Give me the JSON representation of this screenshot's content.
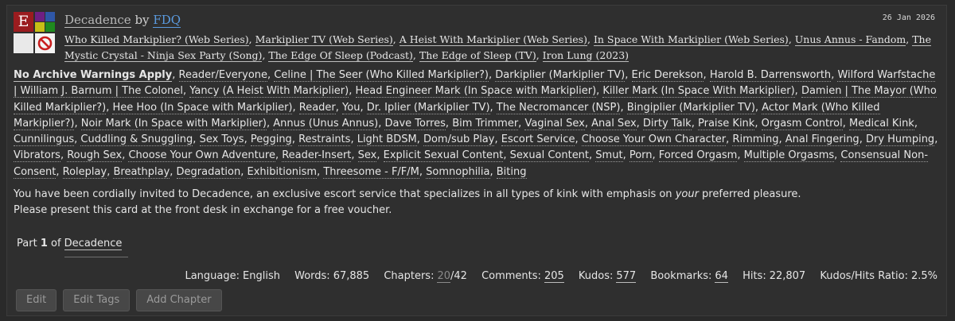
{
  "required_tags": {
    "rating_symbol": "E",
    "rating_color": "#9b1c1f",
    "category_colors": [
      "#6f1f83",
      "#2f57a7",
      "#c8be16",
      "#1f8a1f"
    ],
    "warning_color": "#e9e9e9",
    "status_icon": "no-circle-icon"
  },
  "work": {
    "title": "Decadence",
    "by": "by",
    "author": "FDQ",
    "date": "26 Jan 2026"
  },
  "fandoms": [
    "Who Killed Markiplier? (Web Series)",
    "Markiplier TV (Web Series)",
    "A Heist With Markiplier (Web Series)",
    "In Space With Markiplier (Web Series)",
    "Unus Annus - Fandom",
    "The Mystic Crystal - Ninja Sex Party (Song)",
    "The Edge Of Sleep (Podcast)",
    "The Edge of Sleep (TV)",
    "Iron Lung (2023)"
  ],
  "tags": {
    "warning": "No Archive Warnings Apply",
    "list": [
      "Reader/Everyone",
      "Celine | The Seer (Who Killed Markiplier?)",
      "Darkiplier (Markiplier TV)",
      "Eric Derekson",
      "Harold B. Darrensworth",
      "Wilford Warfstache | William J. Barnum | The Colonel",
      "Yancy (A Heist With Markiplier)",
      "Head Engineer Mark (In Space with Markiplier)",
      "Killer Mark (In Space With Markiplier)",
      "Damien | The Mayor (Who Killed Markiplier?)",
      "Hee Hoo (In Space with Markiplier)",
      "Reader",
      "You",
      "Dr. Iplier (Markiplier TV)",
      "The Necromancer (NSP)",
      "Bingiplier (Markiplier TV)",
      "Actor Mark (Who Killed Markiplier?)",
      "Noir Mark (In Space with Markiplier)",
      "Annus (Unus Annus)",
      "Dave Torres",
      "Bim Trimmer",
      "Vaginal Sex",
      "Anal Sex",
      "Dirty Talk",
      "Praise Kink",
      "Orgasm Control",
      "Medical Kink",
      "Cunnilingus",
      "Cuddling & Snuggling",
      "Sex Toys",
      "Pegging",
      "Restraints",
      "Light BDSM",
      "Dom/sub Play",
      "Escort Service",
      "Choose Your Own Character",
      "Rimming",
      "Anal Fingering",
      "Dry Humping",
      "Vibrators",
      "Rough Sex",
      "Choose Your Own Adventure",
      "Reader-Insert",
      "Sex",
      "Explicit Sexual Content",
      "Sexual Content",
      "Smut",
      "Porn",
      "Forced Orgasm",
      "Multiple Orgasms",
      "Consensual Non-Consent",
      "Roleplay",
      "Breathplay",
      "Degradation",
      "Exhibitionism",
      "Threesome - F/F/M",
      "Somnophilia",
      "Biting"
    ]
  },
  "summary": {
    "line1_before": "You have been cordially invited to Decadence, an exclusive escort service that specializes in all types of kink with emphasis on ",
    "line1_em": "your",
    "line1_after": " preferred pleasure.",
    "line2": "Please present this card at the front desk in exchange for a free voucher."
  },
  "series": {
    "prefix": "Part",
    "number": "1",
    "of": "of",
    "name": "Decadence"
  },
  "stats": {
    "language_label": "Language:",
    "language": "English",
    "words_label": "Words:",
    "words": "67,885",
    "chapters_label": "Chapters:",
    "chapters_current": "20",
    "chapters_total": "/42",
    "comments_label": "Comments:",
    "comments": "205",
    "kudos_label": "Kudos:",
    "kudos": "577",
    "bookmarks_label": "Bookmarks:",
    "bookmarks": "64",
    "hits_label": "Hits:",
    "hits": "22,807",
    "ratio_label": "Kudos/Hits Ratio:",
    "ratio": "2.5%"
  },
  "actions": {
    "edit": "Edit",
    "edit_tags": "Edit Tags",
    "add_chapter": "Add Chapter"
  }
}
